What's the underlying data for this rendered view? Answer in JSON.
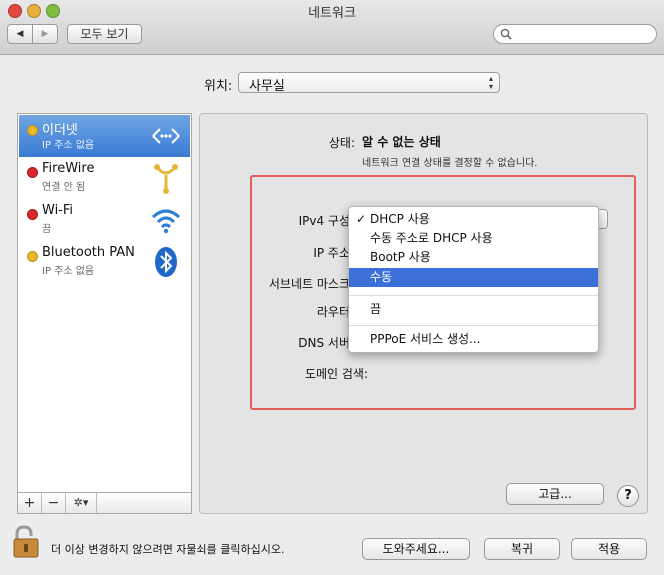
{
  "window": {
    "title": "네트워크"
  },
  "toolbar": {
    "back": "◀",
    "forward": "▶",
    "show_all": "모두 보기",
    "search_placeholder": ""
  },
  "location": {
    "label": "위치:",
    "value": "사무실"
  },
  "services": [
    {
      "name": "이더넷",
      "status": "IP 주소 없음",
      "color": "#e8b82c",
      "icon": "ethernet-icon",
      "selected": true
    },
    {
      "name": "FireWire",
      "status": "연결 안 됨",
      "color": "#d8262b",
      "icon": "firewire-icon",
      "selected": false
    },
    {
      "name": "Wi-Fi",
      "status": "끔",
      "color": "#d8262b",
      "icon": "wifi-icon",
      "selected": false
    },
    {
      "name": "Bluetooth PAN",
      "status": "IP 주소 없음",
      "color": "#e8b82c",
      "icon": "bluetooth-icon",
      "selected": false
    }
  ],
  "sidebar_buttons": {
    "add": "+",
    "remove": "−",
    "gear": "✲▾"
  },
  "status": {
    "label": "상태:",
    "value": "알 수 없는 상태",
    "description": "네트워크 연결 상태를 결정할 수 없습니다."
  },
  "fields": {
    "ipv4": "IPv4 구성",
    "ip": "IP 주소",
    "subnet": "서브네트 마스크",
    "router": "라우터",
    "dns": "DNS 서버",
    "search_domain": "도메인 검색:"
  },
  "ipv4_menu": {
    "check": "✓",
    "items": [
      "DHCP 사용",
      "수동 주소로 DHCP 사용",
      "BootP 사용",
      "수동",
      "끔",
      "PPPoE 서비스 생성..."
    ],
    "checked_index": 0,
    "highlighted_index": 3
  },
  "buttons": {
    "advanced": "고급...",
    "help": "?",
    "assist": "도와주세요...",
    "revert": "복귀",
    "apply": "적용"
  },
  "lock": {
    "text": "더 이상 변경하지 않으려면 자물쇠를 클릭하십시오."
  }
}
